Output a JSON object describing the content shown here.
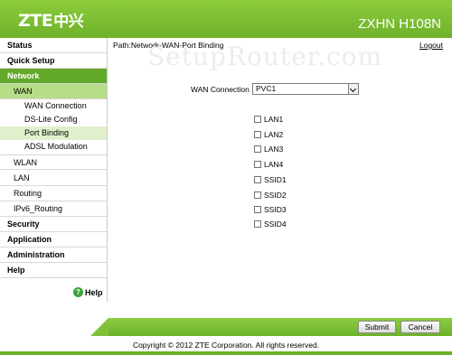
{
  "header": {
    "logo": "ZTE",
    "logo_cn": "中兴",
    "model": "ZXHN H108N",
    "brand_color": "#7fbf33"
  },
  "sidebar": {
    "items": [
      {
        "label": "Status",
        "level": 0,
        "active": false
      },
      {
        "label": "Quick Setup",
        "level": 0,
        "active": false
      },
      {
        "label": "Network",
        "level": 0,
        "active": true
      },
      {
        "label": "WAN",
        "level": 1,
        "active": true
      },
      {
        "label": "WAN Connection",
        "level": 2,
        "active": false
      },
      {
        "label": "DS-Lite Config",
        "level": 2,
        "active": false
      },
      {
        "label": "Port Binding",
        "level": 2,
        "active": true
      },
      {
        "label": "ADSL Modulation",
        "level": 2,
        "active": false
      },
      {
        "label": "WLAN",
        "level": 1,
        "active": false
      },
      {
        "label": "LAN",
        "level": 1,
        "active": false
      },
      {
        "label": "Routing",
        "level": 1,
        "active": false
      },
      {
        "label": "IPv6_Routing",
        "level": 1,
        "active": false
      },
      {
        "label": "Security",
        "level": 0,
        "active": false
      },
      {
        "label": "Application",
        "level": 0,
        "active": false
      },
      {
        "label": "Administration",
        "level": 0,
        "active": false
      },
      {
        "label": "Help",
        "level": 0,
        "active": false
      }
    ],
    "help_label": "Help",
    "help_icon": "question-circle-icon"
  },
  "main": {
    "path": "Path:Network-WAN-Port Binding",
    "logout": "Logout",
    "watermark": "SetupRouter.com",
    "wan_connection_label": "WAN Connection",
    "wan_connection_value": "PVC1",
    "bindings": [
      {
        "label": "LAN1",
        "checked": false
      },
      {
        "label": "LAN2",
        "checked": false
      },
      {
        "label": "LAN3",
        "checked": false
      },
      {
        "label": "LAN4",
        "checked": false
      },
      {
        "label": "SSID1",
        "checked": false
      },
      {
        "label": "SSID2",
        "checked": false
      },
      {
        "label": "SSID3",
        "checked": false
      },
      {
        "label": "SSID4",
        "checked": false
      }
    ]
  },
  "footer": {
    "submit_label": "Submit",
    "cancel_label": "Cancel",
    "copyright": "Copyright © 2012 ZTE Corporation. All rights reserved."
  }
}
